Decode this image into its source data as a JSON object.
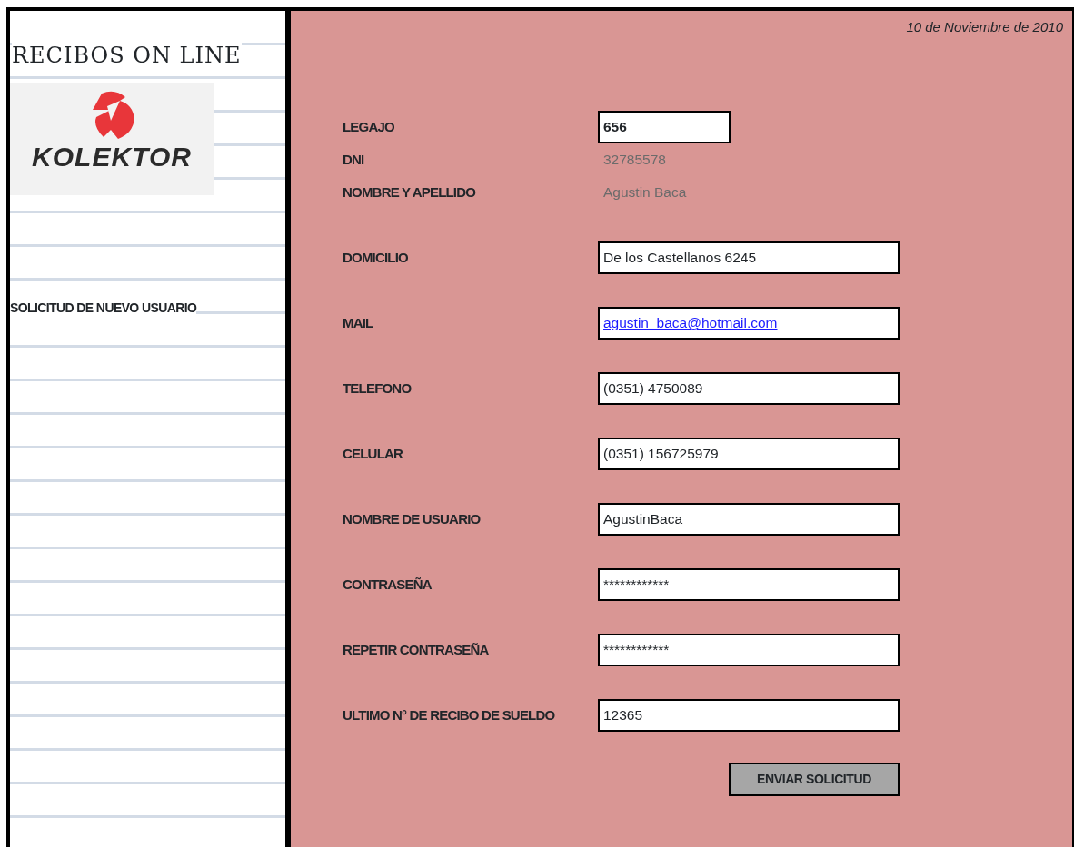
{
  "sidebar": {
    "title": "RECIBOS ON LINE",
    "logo_text": "KOLEKTOR",
    "section": "SOLICITUD DE NUEVO USUARIO"
  },
  "date": "10 de Noviembre de 2010",
  "fields": [
    {
      "label": "LEGAJO",
      "kind": "key",
      "value": "656"
    },
    {
      "label": "DNI",
      "kind": "readonly",
      "value": "32785578"
    },
    {
      "label": "NOMBRE Y APELLIDO",
      "kind": "readonly",
      "value": "Agustin Baca"
    },
    {
      "label": "DOMICILIO",
      "kind": "input",
      "value": "De los Castellanos 6245"
    },
    {
      "label": "MAIL",
      "kind": "link",
      "value": "agustin_baca@hotmail.com"
    },
    {
      "label": "TELEFONO",
      "kind": "input",
      "value": "(0351) 4750089"
    },
    {
      "label": "CELULAR",
      "kind": "input",
      "value": "(0351) 156725979"
    },
    {
      "label": "NOMBRE DE USUARIO",
      "kind": "input",
      "value": "AgustinBaca"
    },
    {
      "label": "CONTRASEÑA",
      "kind": "input",
      "value": "************"
    },
    {
      "label": "REPETIR CONTRASEÑA",
      "kind": "input",
      "value": "************"
    },
    {
      "label": "ULTIMO N° DE RECIBO DE SUELDO",
      "kind": "input",
      "value": "12365"
    }
  ],
  "submit_button": "ENVIAR SOLICITUD"
}
